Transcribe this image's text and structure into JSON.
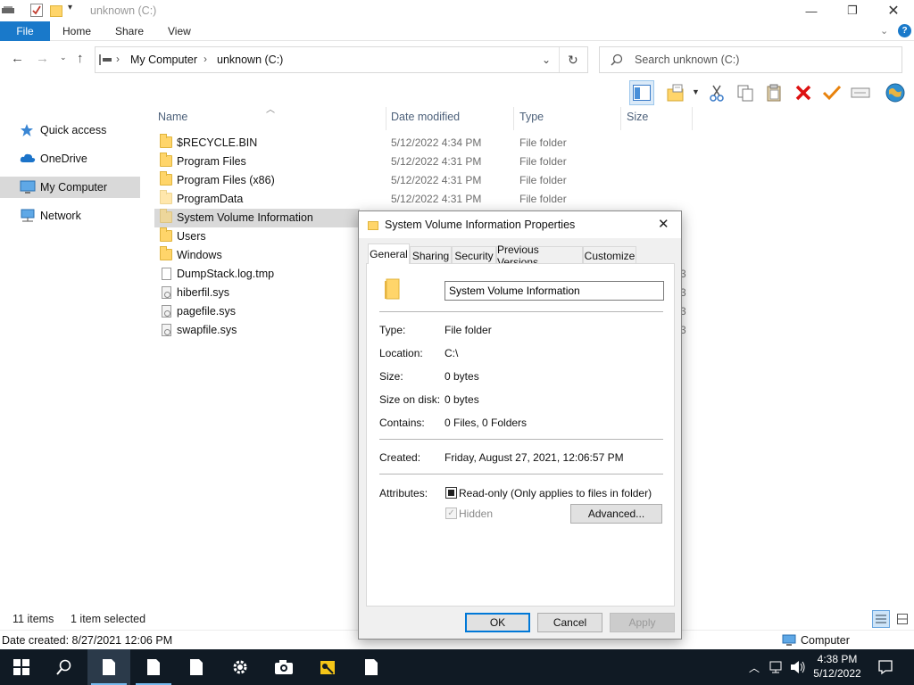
{
  "window": {
    "title": "unknown (C:)",
    "ribbon_tabs": [
      "File",
      "Home",
      "Share",
      "View"
    ]
  },
  "navigation": {
    "address": [
      "My Computer",
      "unknown (C:)"
    ],
    "search_placeholder": "Search unknown (C:)"
  },
  "sidebar": {
    "items": [
      {
        "label": "Quick access",
        "icon": "star-icon"
      },
      {
        "label": "OneDrive",
        "icon": "cloud-icon"
      },
      {
        "label": "My Computer",
        "icon": "computer-icon",
        "selected": true
      },
      {
        "label": "Network",
        "icon": "network-icon"
      }
    ]
  },
  "columns": {
    "name": "Name",
    "date": "Date modified",
    "type": "Type",
    "size": "Size"
  },
  "files": [
    {
      "name": "$RECYCLE.BIN",
      "date": "5/12/2022 4:34 PM",
      "type": "File folder",
      "kind": "folder"
    },
    {
      "name": "Program Files",
      "date": "5/12/2022 4:31 PM",
      "type": "File folder",
      "kind": "folder"
    },
    {
      "name": "Program Files (x86)",
      "date": "5/12/2022 4:31 PM",
      "type": "File folder",
      "kind": "folder"
    },
    {
      "name": "ProgramData",
      "date": "5/12/2022 4:31 PM",
      "type": "File folder",
      "kind": "folder"
    },
    {
      "name": "System Volume Information",
      "date": "",
      "type": "",
      "kind": "folder",
      "selected": true
    },
    {
      "name": "Users",
      "date": "",
      "type": "",
      "kind": "folder"
    },
    {
      "name": "Windows",
      "date": "",
      "type": "",
      "kind": "folder"
    },
    {
      "name": "DumpStack.log.tmp",
      "date": "",
      "type": "",
      "kind": "file"
    },
    {
      "name": "hiberfil.sys",
      "date": "",
      "type": "",
      "kind": "sys"
    },
    {
      "name": "pagefile.sys",
      "date": "",
      "type": "",
      "kind": "sys"
    },
    {
      "name": "swapfile.sys",
      "date": "",
      "type": "",
      "kind": "sys"
    }
  ],
  "status": {
    "items": "11 items",
    "selected": "1 item selected",
    "date_created": "Date created: 8/27/2021 12:06 PM",
    "location": "Computer"
  },
  "dialog": {
    "title": "System Volume Information Properties",
    "tabs": [
      "General",
      "Sharing",
      "Security",
      "Previous Versions",
      "Customize"
    ],
    "name": "System Volume Information",
    "type_label": "Type:",
    "type_value": "File folder",
    "location_label": "Location:",
    "location_value": "C:\\",
    "size_label": "Size:",
    "size_value": "0 bytes",
    "size_on_disk_label": "Size on disk:",
    "size_on_disk_value": "0 bytes",
    "contains_label": "Contains:",
    "contains_value": "0 Files, 0 Folders",
    "created_label": "Created:",
    "created_value": "Friday, August 27, 2021, 12:06:57 PM",
    "attributes_label": "Attributes:",
    "readonly_label": "Read-only (Only applies to files in folder)",
    "hidden_label": "Hidden",
    "advanced_label": "Advanced...",
    "ok_label": "OK",
    "cancel_label": "Cancel",
    "apply_label": "Apply"
  },
  "taskbar": {
    "time": "4:38 PM",
    "date": "5/12/2022"
  },
  "colors": {
    "accent": "#1979ca",
    "taskbar": "#101a24",
    "selection": "#d9d9d9"
  }
}
